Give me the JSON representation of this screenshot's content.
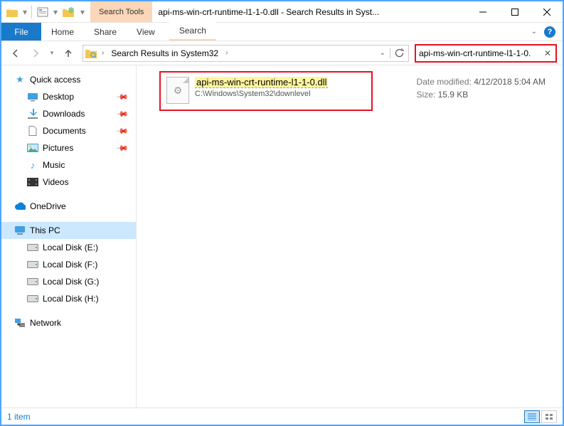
{
  "titlebar": {
    "context_tab": "Search Tools",
    "title": "api-ms-win-crt-runtime-l1-1-0.dll - Search Results in Syst..."
  },
  "ribbon": {
    "file": "File",
    "tabs": [
      "Home",
      "Share",
      "View"
    ],
    "search_tab": "Search"
  },
  "address": {
    "location": "Search Results in System32"
  },
  "search": {
    "value": "api-ms-win-crt-runtime-l1-1-0."
  },
  "nav": {
    "quick_access": "Quick access",
    "quick_items": [
      {
        "label": "Desktop",
        "icon": "desktop"
      },
      {
        "label": "Downloads",
        "icon": "download"
      },
      {
        "label": "Documents",
        "icon": "document"
      },
      {
        "label": "Pictures",
        "icon": "picture"
      },
      {
        "label": "Music",
        "icon": "music"
      },
      {
        "label": "Videos",
        "icon": "video"
      }
    ],
    "onedrive": "OneDrive",
    "this_pc": "This PC",
    "drives": [
      {
        "label": "Local Disk (E:)"
      },
      {
        "label": "Local Disk (F:)"
      },
      {
        "label": "Local Disk (G:)"
      },
      {
        "label": "Local Disk (H:)"
      }
    ],
    "network": "Network"
  },
  "result": {
    "filename": "api-ms-win-crt-runtime-l1-1-0.dll",
    "path": "C:\\Windows\\System32\\downlevel",
    "date_label": "Date modified:",
    "date": "4/12/2018 5:04 AM",
    "size_label": "Size:",
    "size": "15.9 KB"
  },
  "status": {
    "count": "1 item"
  }
}
